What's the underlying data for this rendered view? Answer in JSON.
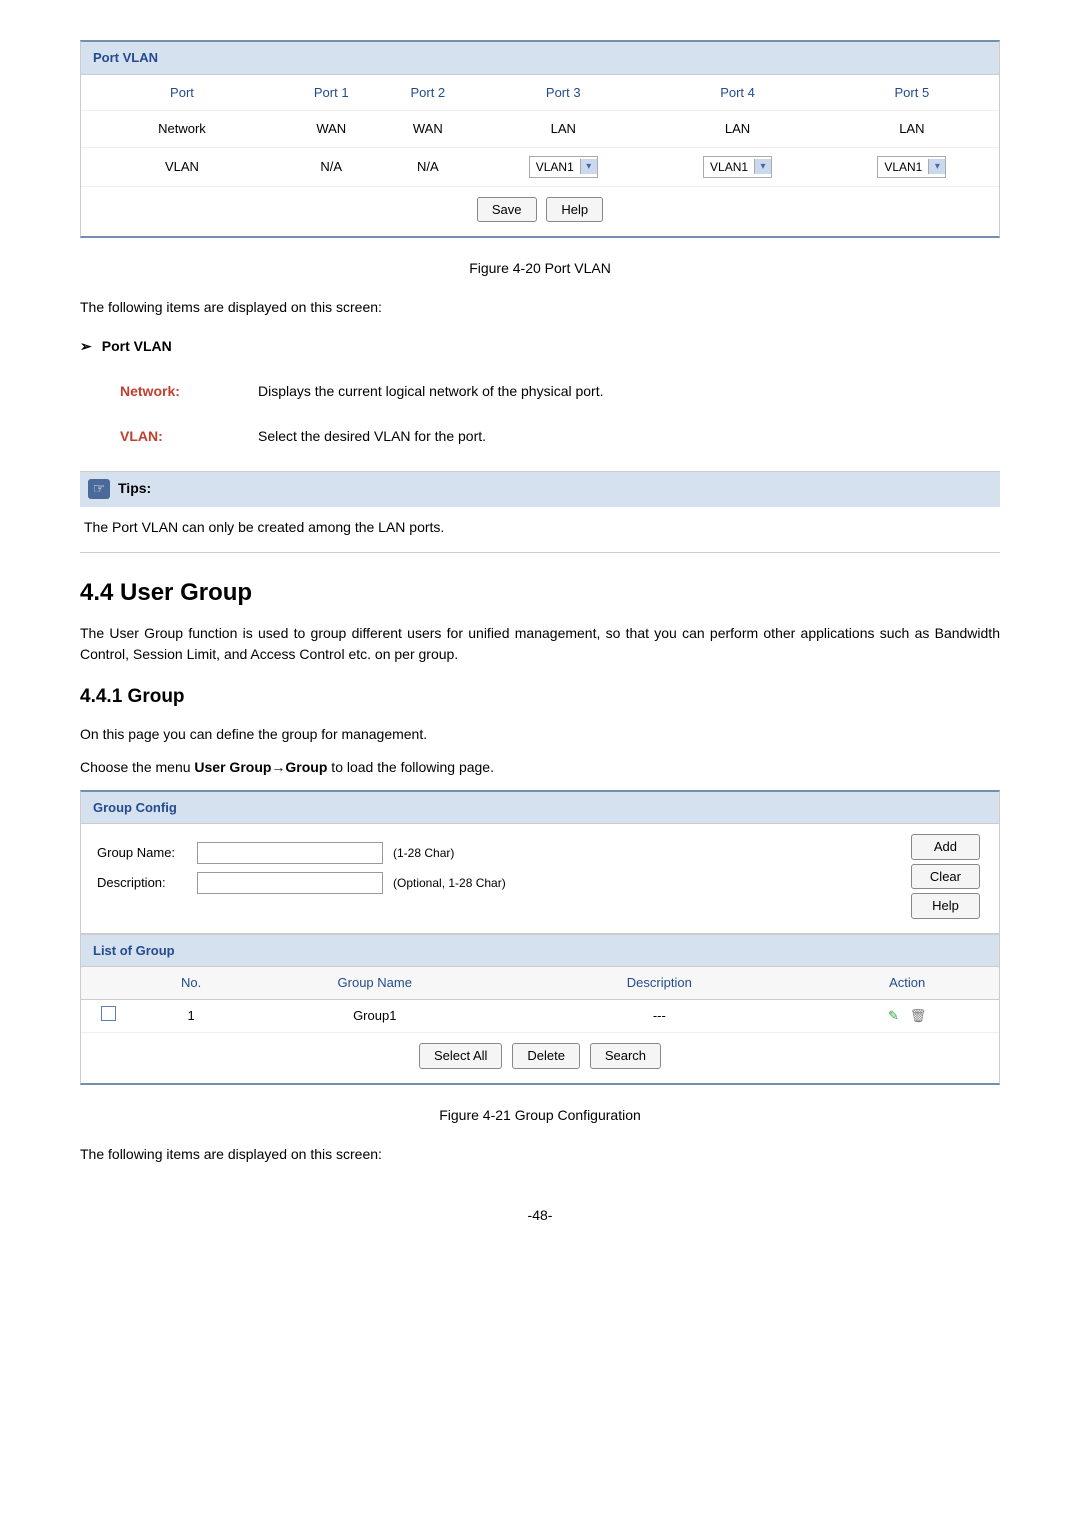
{
  "portvlan_panel": {
    "title": "Port VLAN",
    "row_port": "Port",
    "row_network": "Network",
    "row_vlan": "VLAN",
    "cols": {
      "p1": "Port 1",
      "p2": "Port 2",
      "p3": "Port 3",
      "p4": "Port 4",
      "p5": "Port 5"
    },
    "net": {
      "p1": "WAN",
      "p2": "WAN",
      "p3": "LAN",
      "p4": "LAN",
      "p5": "LAN"
    },
    "vlan_na": "N/A",
    "vlan_sel": "VLAN1",
    "save": "Save",
    "help": "Help"
  },
  "fig420": "Figure 4-20 Port VLAN",
  "intro1": "The following items are displayed on this screen:",
  "sect_portvlan": "Port VLAN",
  "desc_network_label": "Network:",
  "desc_network_text": "Displays the current logical network of the physical port.",
  "desc_vlan_label": "VLAN:",
  "desc_vlan_text": "Select the desired VLAN for the port.",
  "tips_label": "Tips:",
  "tips_body": "The Port VLAN can only be created among the LAN ports.",
  "h44": "4.4  User Group",
  "p44": "The User Group function is used to group different users for unified management, so that you can perform other applications such as Bandwidth Control, Session Limit, and Access Control etc. on per group.",
  "h441": "4.4.1  Group",
  "p441a": "On this page you can define the group for management.",
  "p441b_pre": "Choose the menu ",
  "p441b_bold": "User Group→Group",
  "p441b_post": " to load the following page.",
  "group_panel": {
    "title": "Group Config",
    "gn_label": "Group Name:",
    "gn_hint": "(1-28 Char)",
    "desc_label": "Description:",
    "desc_hint": "(Optional, 1-28 Char)",
    "add": "Add",
    "clear": "Clear",
    "help": "Help",
    "list_title": "List of Group",
    "th_no": "No.",
    "th_gn": "Group Name",
    "th_desc": "Description",
    "th_action": "Action",
    "row1_no": "1",
    "row1_gn": "Group1",
    "row1_desc": "---",
    "select_all": "Select All",
    "delete": "Delete",
    "search": "Search"
  },
  "fig421": "Figure 4-21 Group Configuration",
  "outro": "The following items are displayed on this screen:",
  "pagenum": "-48-",
  "chart_data": null
}
